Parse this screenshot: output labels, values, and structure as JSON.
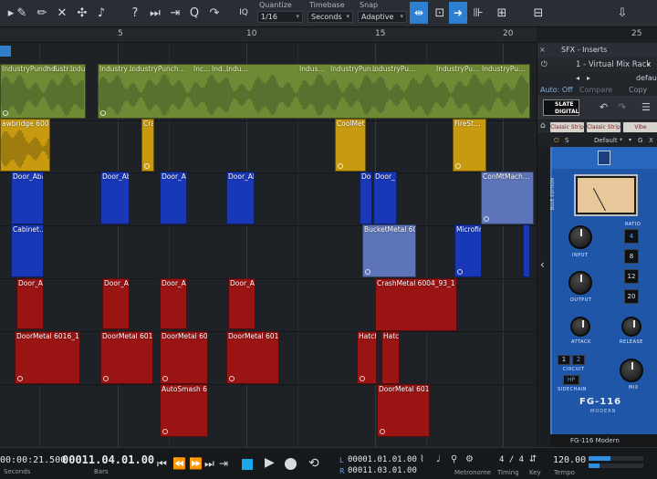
{
  "colors": {
    "accent": "#2e7fd0",
    "green_clip": "#6f8a35",
    "yellow_clip": "#c79a10",
    "blue_clip": "#1838b8",
    "red_clip": "#9b1414",
    "unit_blue": "#1f56a8"
  },
  "toolbar": {
    "quantize_label": "Quantize",
    "quantize_value": "1/16",
    "timebase_label": "Timebase",
    "timebase_value": "Seconds",
    "snap_label": "Snap",
    "snap_value": "Adaptive",
    "iq_label": "IQ"
  },
  "ruler": {
    "marks": [
      "5",
      "10",
      "15",
      "20",
      "25"
    ]
  },
  "tracks": {
    "green": [
      "IndustryPunch 6…",
      "Industr…",
      "Indus…",
      "Industry…",
      "IndustryPunch…",
      "Inc…",
      "Ind…",
      "Indu…",
      "Indus…",
      "IndustryPun…",
      "IndustryPu…",
      "IndustryPu…",
      "IndustryPu…",
      "IndustryP…"
    ],
    "yellow": [
      "awbridge 6004_93",
      "Cra…",
      "CoolMetal",
      "FireSt…"
    ],
    "blue1": [
      "Door_Aba…",
      "Door_Ab…",
      "Door_Ab…",
      "Door_Ab…",
      "Door",
      "Door_",
      "ConMtMach…"
    ],
    "blue2": [
      "Cabinet…",
      "BucketMetal 601…",
      "Microfir…"
    ],
    "red1": [
      "Door_Ab…",
      "Door_Ab…",
      "Door_Ab…",
      "Door_Ab…",
      "CrashMetal 6004_93_1"
    ],
    "red2": [
      "DoorMetal 6016_16…",
      "DoorMetal 6016…",
      "DoorMetal 601…",
      "DoorMetal 6016…",
      "Hatch…",
      "Hatch…"
    ],
    "red3": [
      "AutoSmash 600…",
      "DoorMetal 6016…"
    ]
  },
  "panel": {
    "header": "SFX - Inserts",
    "rack": "1 - Virtual Mix Rack",
    "default_label": "default",
    "auto_off": "Auto: Off",
    "compare": "Compare",
    "copy": "Copy",
    "brand": "SLATE DIGITAL",
    "strip_tab_1": "Classic Strip",
    "strip_tab_2": "Classic Strip",
    "strip_tab_3": "Vibe",
    "preset": "Default *",
    "preset_s": "S",
    "preset_g": "G",
    "preset_x": "X",
    "unit_side": "BLUE EDITION",
    "knob_input": "INPUT",
    "knob_output": "OUTPUT",
    "knob_attack": "ATTACK",
    "knob_release": "RELEASE",
    "knob_mix": "MIX",
    "ratio_label": "RATIO",
    "ratios": [
      "4",
      "8",
      "12",
      "20"
    ],
    "circuit_label": "CIRCUIT",
    "circuit_1": "1",
    "circuit_2": "2",
    "hp_label": "HP",
    "sidechain_label": "SIDECHAIN",
    "unit_name": "FG-116",
    "unit_sub": "MODERN",
    "footer": "FG-116 Modern"
  },
  "transport": {
    "time": "00:00:21.500",
    "time_label": "Seconds",
    "bars": "00011.04.01.00",
    "bars_label": "Bars",
    "loop_l": "00001.01.01.00",
    "loop_r": "00011.03.01.00",
    "loop_l_label": "L",
    "loop_r_label": "R",
    "metronome_label": "Metronome",
    "timing_value": "4 / 4",
    "timing_label": "Timing",
    "key_label": "Key",
    "tempo_value": "120.00",
    "tempo_label": "Tempo"
  }
}
